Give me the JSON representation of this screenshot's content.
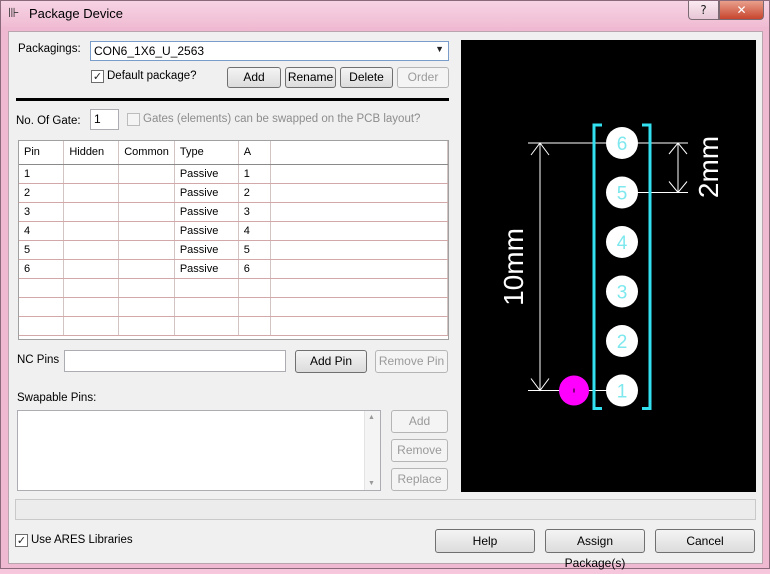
{
  "window": {
    "title": "Package Device",
    "help_label": "?",
    "close_label": "✕"
  },
  "packagings": {
    "label": "Packagings:",
    "selected": "CON6_1X6_U_2563",
    "default_label": "Default package?",
    "default_checked": true,
    "add_label": "Add",
    "rename_label": "Rename",
    "delete_label": "Delete",
    "order_label": "Order"
  },
  "gates": {
    "label": "No. Of Gate:",
    "value": "1",
    "swap_label": "Gates (elements) can be swapped on the PCB layout?",
    "swap_checked": false
  },
  "pin_table": {
    "columns": [
      "Pin",
      "Hidden",
      "Common",
      "Type",
      "A"
    ],
    "rows": [
      [
        "1",
        "",
        "",
        "Passive",
        "1"
      ],
      [
        "2",
        "",
        "",
        "Passive",
        "2"
      ],
      [
        "3",
        "",
        "",
        "Passive",
        "3"
      ],
      [
        "4",
        "",
        "",
        "Passive",
        "4"
      ],
      [
        "5",
        "",
        "",
        "Passive",
        "5"
      ],
      [
        "6",
        "",
        "",
        "Passive",
        "6"
      ]
    ],
    "empty_rows": 3
  },
  "nc_pins": {
    "label": "NC Pins",
    "value": "",
    "add_pin_label": "Add Pin",
    "remove_pin_label": "Remove Pin"
  },
  "swapable": {
    "label": "Swapable Pins:",
    "add_label": "Add",
    "remove_label": "Remove",
    "replace_label": "Replace"
  },
  "footer": {
    "ares_label": "Use ARES Libraries",
    "ares_checked": true,
    "help_label": "Help",
    "assign_label": "Assign Package(s)",
    "cancel_label": "Cancel"
  },
  "preview": {
    "pin_labels": [
      "6",
      "5",
      "4",
      "3",
      "2",
      "1"
    ],
    "dimension_vertical": "10mm",
    "dimension_pitch": "2mm",
    "colors": {
      "pad": "#ffffff",
      "pad_label": "#7ee8ee",
      "outline": "#33e0f0",
      "origin": "#ff00ff",
      "dimension": "#ffffff",
      "background": "#000000"
    }
  }
}
